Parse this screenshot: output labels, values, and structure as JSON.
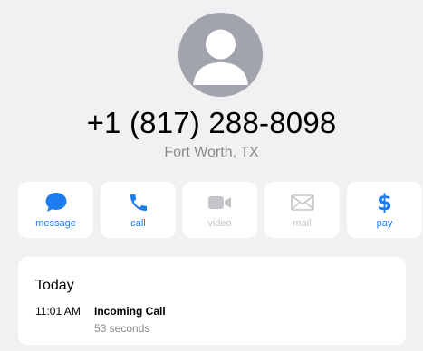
{
  "contact": {
    "avatar_icon": "person-silhouette-icon",
    "phone_number": "+1 (817) 288-8098",
    "location": "Fort Worth, TX"
  },
  "actions": [
    {
      "label": "message",
      "icon": "message-bubble-icon",
      "enabled": true
    },
    {
      "label": "call",
      "icon": "phone-icon",
      "enabled": true
    },
    {
      "label": "video",
      "icon": "video-camera-icon",
      "enabled": false
    },
    {
      "label": "mail",
      "icon": "envelope-icon",
      "enabled": false
    },
    {
      "label": "pay",
      "icon": "dollar-icon",
      "glyph": "$",
      "enabled": true
    }
  ],
  "recents": {
    "day": "Today",
    "entries": [
      {
        "time": "11:01 AM",
        "type": "Incoming Call",
        "duration": "53 seconds"
      }
    ]
  },
  "colors": {
    "accent": "#1d7cf2",
    "disabled": "#c4c4c9",
    "background": "#f1f1f3",
    "card": "#ffffff",
    "avatar": "#a2a4ad",
    "secondary_text": "#8a8a8e"
  }
}
